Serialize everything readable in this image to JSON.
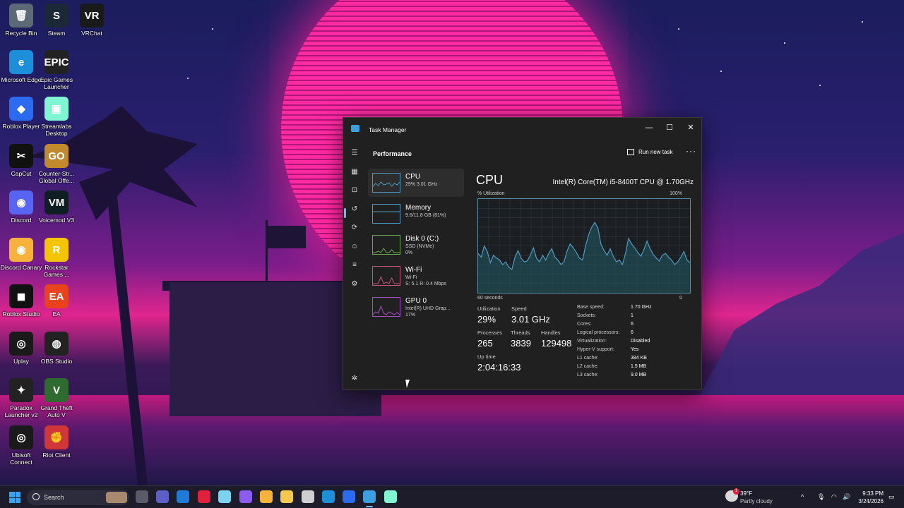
{
  "desktop_icons": [
    {
      "label": "Recycle Bin",
      "glyph": "🗑",
      "color": "#5c6a78"
    },
    {
      "label": "Steam",
      "glyph": "S",
      "color": "#1b2838"
    },
    {
      "label": "VRChat",
      "glyph": "VR",
      "color": "#1a1a1a"
    },
    {
      "label": "Microsoft Edge",
      "glyph": "e",
      "color": "#1d8fd8"
    },
    {
      "label": "Epic Games Launcher",
      "glyph": "EPIC",
      "color": "#222"
    },
    {
      "label": "Roblox Player",
      "glyph": "◆",
      "color": "#2a6bf0"
    },
    {
      "label": "Streamlabs Desktop",
      "glyph": "▣",
      "color": "#80f5d2"
    },
    {
      "label": "CapCut",
      "glyph": "✂",
      "color": "#111"
    },
    {
      "label": "Counter-Str... Global Offe...",
      "glyph": "GO",
      "color": "#c28a2e"
    },
    {
      "label": "Discord",
      "glyph": "◉",
      "color": "#5865f2"
    },
    {
      "label": "Voicemod V3",
      "glyph": "VM",
      "color": "#0f1e22"
    },
    {
      "label": "Discord Canary",
      "glyph": "◉",
      "color": "#f6b23b"
    },
    {
      "label": "Rockstar Games ...",
      "glyph": "R",
      "color": "#f4c400"
    },
    {
      "label": "Roblox Studio",
      "glyph": "◼",
      "color": "#111"
    },
    {
      "label": "EA",
      "glyph": "EA",
      "color": "#e8431c"
    },
    {
      "label": "Uplay",
      "glyph": "◎",
      "color": "#1a1a1a"
    },
    {
      "label": "OBS Studio",
      "glyph": "◍",
      "color": "#222"
    },
    {
      "label": "Paradox Launcher v2",
      "glyph": "✦",
      "color": "#222"
    },
    {
      "label": "Grand Theft Auto V",
      "glyph": "V",
      "color": "#2e6b2e"
    },
    {
      "label": "Ubisoft Connect",
      "glyph": "◎",
      "color": "#1a1a1a"
    },
    {
      "label": "Riot Client",
      "glyph": "✊",
      "color": "#d13639"
    }
  ],
  "task_manager": {
    "window_title": "Task Manager",
    "section_title": "Performance",
    "run_new_task": "Run new task",
    "more_options": "···",
    "window_controls": {
      "minimize": "—",
      "maximize": "☐",
      "close": "✕"
    },
    "nav_icons": [
      "hamburger-icon",
      "processes-icon",
      "performance-icon",
      "app-history-icon",
      "startup-apps-icon",
      "users-icon",
      "details-icon",
      "services-icon",
      "settings-icon"
    ],
    "perf_items": [
      {
        "name": "CPU",
        "sub1": "29% 3.01 GHz",
        "sub2": "",
        "border": "#4f9bc4",
        "line": "#4f9bc4",
        "active": true
      },
      {
        "name": "Memory",
        "sub1": "9.6/11.8 GB (81%)",
        "sub2": "",
        "border": "#4f9bc4",
        "line": "#4f9bc4",
        "active": false
      },
      {
        "name": "Disk 0 (C:)",
        "sub1": "SSD (NVMe)",
        "sub2": "0%",
        "border": "#6aa84f",
        "line": "#6aa84f",
        "active": false
      },
      {
        "name": "Wi-Fi",
        "sub1": "Wi-Fi",
        "sub2": "S: 5.1 R: 0.4 Mbps",
        "border": "#c4577a",
        "line": "#c4577a",
        "active": false
      },
      {
        "name": "GPU 0",
        "sub1": "Intel(R) UHD Grap...",
        "sub2": "17%",
        "border": "#a64fc4",
        "line": "#a64fc4",
        "active": false
      }
    ],
    "cpu": {
      "title": "CPU",
      "model": "Intel(R) Core(TM) i5-8400T CPU @ 1.70GHz",
      "util_label": "% Utilization",
      "util_max": "100%",
      "time_label": "60 seconds",
      "time_min": "0",
      "stats": {
        "utilization_label": "Utilization",
        "utilization": "29%",
        "speed_label": "Speed",
        "speed": "3.01 GHz",
        "processes_label": "Processes",
        "processes": "265",
        "threads_label": "Threads",
        "threads": "3839",
        "handles_label": "Handles",
        "handles": "129498",
        "uptime_label": "Up time",
        "uptime": "2:04:16:33"
      },
      "specs": [
        {
          "k": "Base speed:",
          "v": "1.70 GHz"
        },
        {
          "k": "Sockets:",
          "v": "1"
        },
        {
          "k": "Cores:",
          "v": "6"
        },
        {
          "k": "Logical processors:",
          "v": "6"
        },
        {
          "k": "Virtualization:",
          "v": "Disabled"
        },
        {
          "k": "Hyper-V support:",
          "v": "Yes"
        },
        {
          "k": "L1 cache:",
          "v": "384 KB"
        },
        {
          "k": "L2 cache:",
          "v": "1.5 MB"
        },
        {
          "k": "L3 cache:",
          "v": "9.0 MB"
        }
      ],
      "history": [
        42,
        38,
        50,
        44,
        32,
        40,
        37,
        35,
        30,
        33,
        27,
        25,
        38,
        45,
        37,
        33,
        34,
        40,
        48,
        37,
        33,
        40,
        35,
        42,
        47,
        38,
        35,
        30,
        33,
        45,
        52,
        48,
        43,
        37,
        35,
        50,
        62,
        70,
        75,
        69,
        52,
        45,
        40,
        47,
        39,
        33,
        35,
        30,
        42,
        58,
        52,
        48,
        43,
        39,
        46,
        55,
        47,
        41,
        37,
        34,
        40,
        42,
        38,
        35,
        30,
        33,
        38,
        44,
        35,
        32
      ],
      "accent": "#4f9bc4"
    }
  },
  "taskbar": {
    "search_text": "Search",
    "weather_temp": "39°F",
    "weather_cond": "Partly cloudy",
    "weather_badge": "1",
    "time": "9:33 PM",
    "date": "3/24/2026",
    "apps": [
      {
        "name": "task-view-icon",
        "color": "#5a5a6a"
      },
      {
        "name": "teams-icon",
        "color": "#5b5fc7"
      },
      {
        "name": "outlook-icon",
        "color": "#1f7bd8"
      },
      {
        "name": "opera-icon",
        "color": "#e0203c"
      },
      {
        "name": "copilot-icon",
        "color": "#7bd3f0"
      },
      {
        "name": "messenger-icon",
        "color": "#8a5cf0"
      },
      {
        "name": "discord-canary-icon",
        "color": "#f6b23b"
      },
      {
        "name": "file-explorer-icon",
        "color": "#f2c94c"
      },
      {
        "name": "settings-icon",
        "color": "#cfcfcf"
      },
      {
        "name": "edge-icon",
        "color": "#1d8fd8"
      },
      {
        "name": "roblox-icon",
        "color": "#2a6bf0"
      },
      {
        "name": "task-manager-icon",
        "color": "#3aa0e0"
      },
      {
        "name": "streamlabs-icon",
        "color": "#80f5d2"
      }
    ]
  }
}
